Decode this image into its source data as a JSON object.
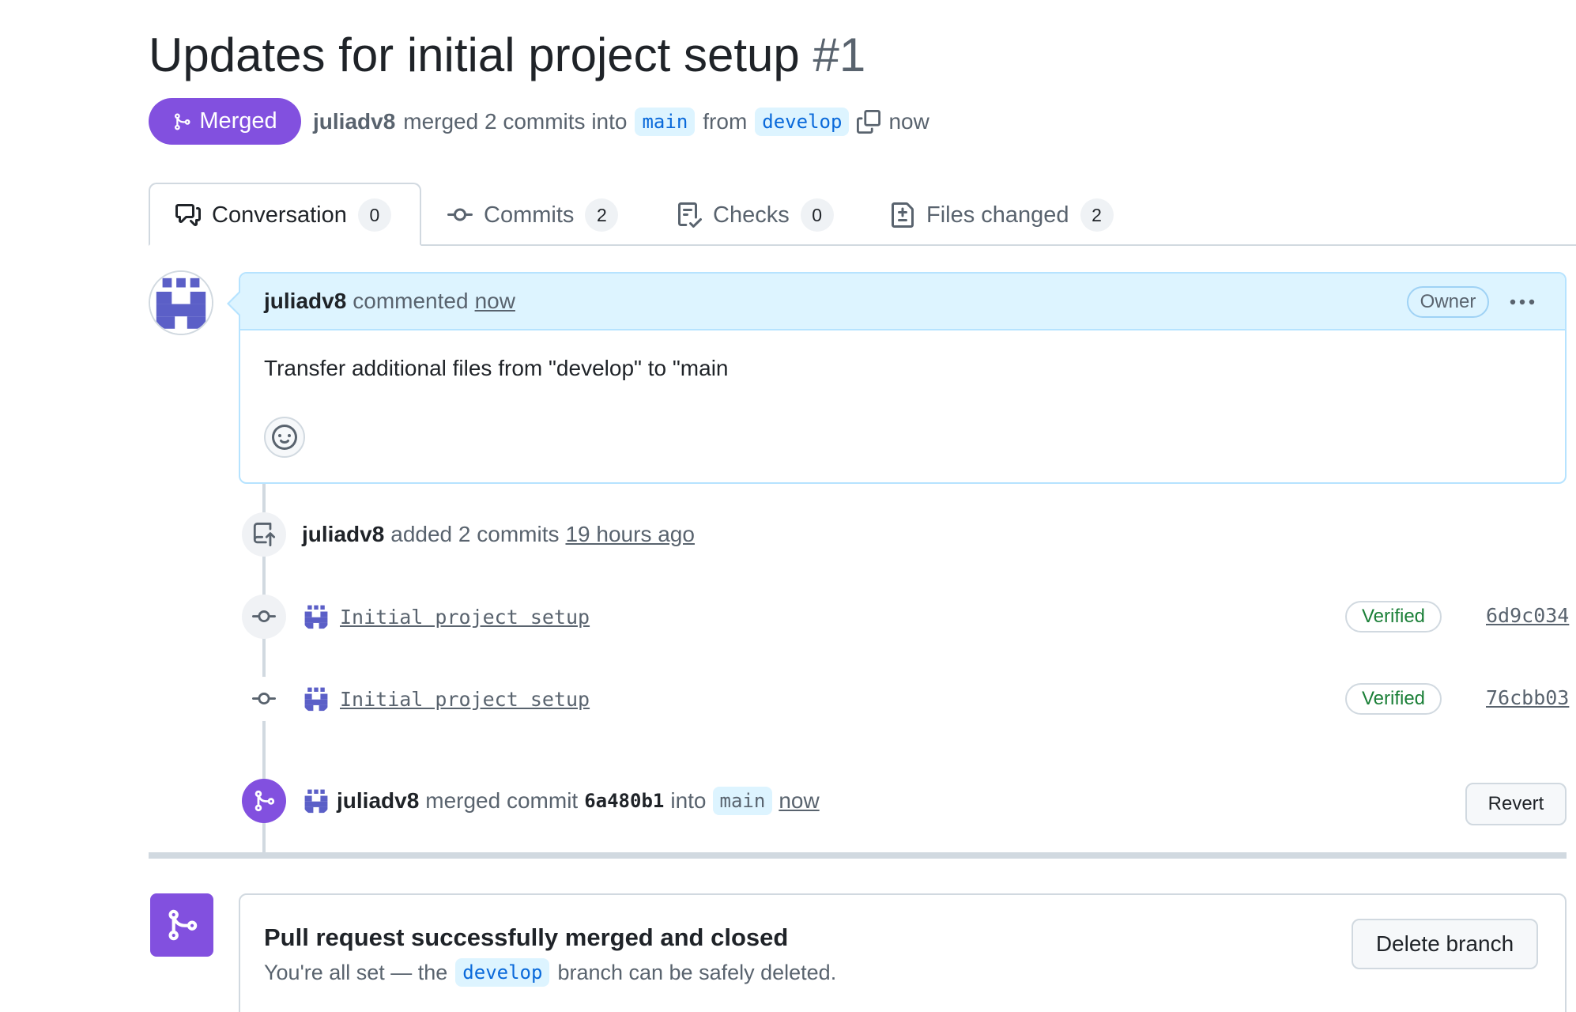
{
  "header": {
    "title": "Updates for initial project setup",
    "number": "#1",
    "state_badge": "Merged",
    "author": "juliadv8",
    "merge_text": "merged 2 commits into",
    "base_branch": "main",
    "from_text": "from",
    "head_branch": "develop",
    "time": "now"
  },
  "tabs": [
    {
      "label": "Conversation",
      "count": "0",
      "icon": "comment-discussion-icon"
    },
    {
      "label": "Commits",
      "count": "2",
      "icon": "git-commit-icon"
    },
    {
      "label": "Checks",
      "count": "0",
      "icon": "checklist-icon"
    },
    {
      "label": "Files changed",
      "count": "2",
      "icon": "file-diff-icon"
    }
  ],
  "comment": {
    "author": "juliadv8",
    "action": "commented",
    "time": "now",
    "role_badge": "Owner",
    "body": "Transfer additional files from \"develop\" to \"main"
  },
  "timeline": {
    "push_event": {
      "author": "juliadv8",
      "text": "added 2 commits",
      "time": "19 hours ago"
    },
    "commits": [
      {
        "message": "Initial project setup",
        "verified": "Verified",
        "sha": "6d9c034"
      },
      {
        "message": "Initial project setup",
        "verified": "Verified",
        "sha": "76cbb03"
      }
    ],
    "merge_event": {
      "author": "juliadv8",
      "text": "merged commit",
      "sha": "6a480b1",
      "into_text": "into",
      "branch": "main",
      "time": "now",
      "revert_label": "Revert"
    }
  },
  "merged_box": {
    "title": "Pull request successfully merged and closed",
    "sub_prefix": "You're all set — the",
    "branch": "develop",
    "sub_suffix": "branch can be safely deleted.",
    "delete_label": "Delete branch"
  },
  "colors": {
    "merged_purple": "#8250df",
    "link_blue": "#0969da",
    "verified_green": "#1a7f37",
    "comment_header_bg": "#ddf4ff",
    "border": "#d1d9e0"
  }
}
